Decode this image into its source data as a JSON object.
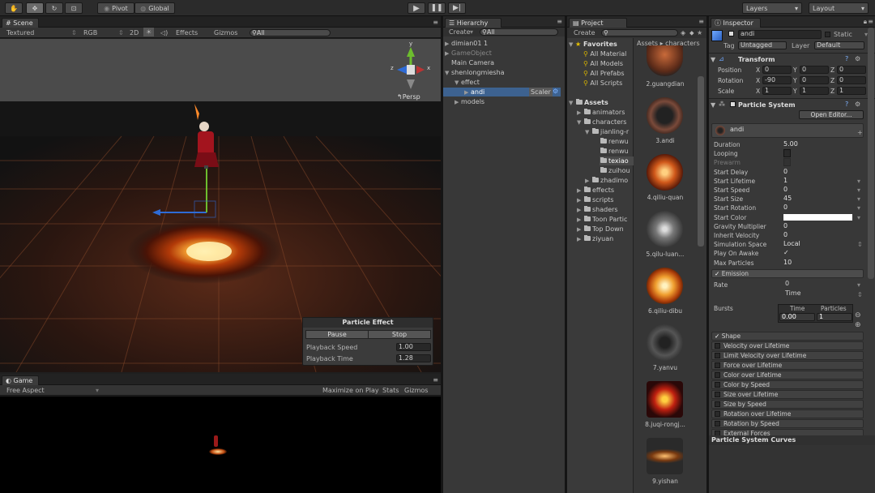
{
  "toolbar": {
    "pivot": "Pivot",
    "global": "Global",
    "layers": "Layers",
    "layout": "Layout"
  },
  "scene": {
    "tab": "Scene",
    "shading": "Textured",
    "render": "RGB",
    "mode2d": "2D",
    "effects": "Effects",
    "gizmos": "Gizmos",
    "search_prefix": "All",
    "gizmo_axes": {
      "x": "x",
      "y": "y",
      "z": "z"
    },
    "persp": "Persp"
  },
  "particle_effect": {
    "title": "Particle Effect",
    "pause": "Pause",
    "stop": "Stop",
    "playback_speed_label": "Playback Speed",
    "playback_speed": "1.00",
    "playback_time_label": "Playback Time",
    "playback_time": "1.28"
  },
  "game": {
    "tab": "Game",
    "aspect": "Free Aspect",
    "maximize": "Maximize on Play",
    "stats": "Stats",
    "gizmos": "Gizmos"
  },
  "hierarchy": {
    "tab": "Hierarchy",
    "create": "Create",
    "search_prefix": "All",
    "items": [
      "dimian01 1",
      "GameObject",
      "Main Camera",
      "shenlongmiesha",
      "effect",
      "andi",
      "models"
    ],
    "scaler": "Scaler"
  },
  "project": {
    "tab": "Project",
    "create": "Create",
    "breadcrumb": [
      "Assets",
      "characters"
    ],
    "favorites": "Favorites",
    "fav_items": [
      "All Material",
      "All Models",
      "All Prefabs",
      "All Scripts"
    ],
    "assets": "Assets",
    "tree": [
      "animators",
      "characters",
      "jianling-r",
      "renwu",
      "renwu",
      "texiao",
      "zuihou",
      "zhadimo",
      "effects",
      "scripts",
      "shaders",
      "Toon Partic",
      "Top Down",
      "ziyuan"
    ],
    "thumbs": [
      "2.guangdian",
      "3.andi",
      "4.qiliu-quan",
      "5.qilu-luan...",
      "6.qiliu-dibu",
      "7.yanvu",
      "8.juqi-rongj...",
      "9.yishan"
    ]
  },
  "inspector": {
    "tab": "Inspector",
    "name": "andi",
    "static": "Static",
    "tag_label": "Tag",
    "tag": "Untagged",
    "layer_label": "Layer",
    "layer": "Default",
    "transform": {
      "title": "Transform",
      "position_label": "Position",
      "rotation_label": "Rotation",
      "scale_label": "Scale",
      "position": [
        "0",
        "0",
        "0"
      ],
      "rotation": [
        "-90",
        "0",
        "0"
      ],
      "scale": [
        "1",
        "1",
        "1"
      ],
      "axes": [
        "X",
        "Y",
        "Z"
      ]
    },
    "ps": {
      "title": "Particle System",
      "open_editor": "Open Editor...",
      "name": "andi",
      "props": [
        {
          "label": "Duration",
          "value": "5.00"
        },
        {
          "label": "Looping",
          "value": ""
        },
        {
          "label": "Prewarm",
          "value": ""
        },
        {
          "label": "Start Delay",
          "value": "0"
        },
        {
          "label": "Start Lifetime",
          "value": "1"
        },
        {
          "label": "Start Speed",
          "value": "0"
        },
        {
          "label": "Start Size",
          "value": "45"
        },
        {
          "label": "Start Rotation",
          "value": "0"
        },
        {
          "label": "Start Color",
          "value": ""
        },
        {
          "label": "Gravity Multiplier",
          "value": "0"
        },
        {
          "label": "Inherit Velocity",
          "value": "0"
        },
        {
          "label": "Simulation Space",
          "value": "Local"
        },
        {
          "label": "Play On Awake",
          "value": "✓"
        },
        {
          "label": "Max Particles",
          "value": "10"
        }
      ],
      "emission": "Emission",
      "rate_label": "Rate",
      "rate": "0",
      "time": "Time",
      "bursts_label": "Bursts",
      "bursts_time_hdr": "Time",
      "bursts_particles_hdr": "Particles",
      "burst_time": "0.00",
      "burst_particles": "1",
      "modules": [
        "Shape",
        "Velocity over Lifetime",
        "Limit Velocity over Lifetime",
        "Force over Lifetime",
        "Color over Lifetime",
        "Color by Speed",
        "Size over Lifetime",
        "Size by Speed",
        "Rotation over Lifetime",
        "Rotation by Speed",
        "External Forces"
      ],
      "curves": "Particle System Curves"
    }
  }
}
